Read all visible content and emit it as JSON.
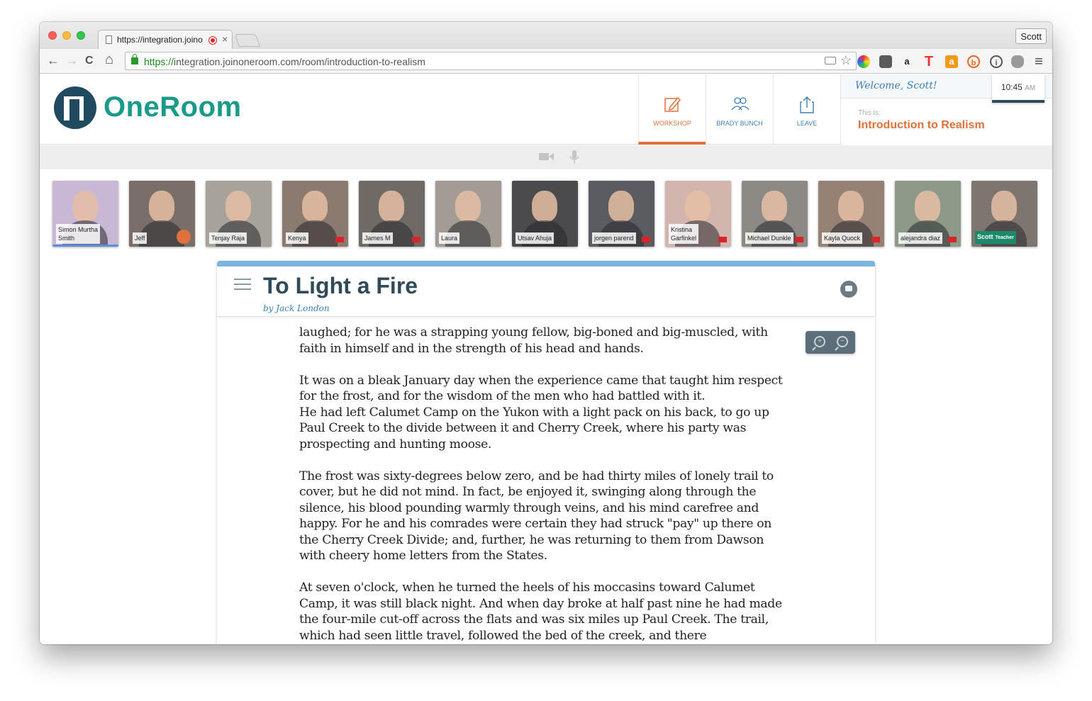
{
  "browser": {
    "tab_title": "https://integration.joino",
    "tab_close": "×",
    "profile": "Scott",
    "url_scheme": "https://",
    "url_rest": "integration.joinoneroom.com/room/introduction-to-realism",
    "nav_back": "←",
    "nav_forward": "→",
    "nav_reload": "C",
    "nav_home": "⌂",
    "star": "☆",
    "menu": "≡"
  },
  "app": {
    "logo_text": "OneRoom",
    "nav": [
      {
        "label": "WORKSHOP",
        "icon": "pencil-edit-icon",
        "active": true
      },
      {
        "label": "BRADY BUNCH",
        "icon": "people-icon",
        "active": false
      },
      {
        "label": "LEAVE",
        "icon": "share-exit-icon",
        "active": false
      }
    ],
    "welcome": "Welcome, Scott!",
    "clock_time": "10:45",
    "clock_ampm": "AM",
    "this_is": "This is:",
    "course_name": "Introduction to Realism"
  },
  "participants": [
    {
      "name": "Simon Murtha Smith",
      "line1": "Simon Murtha",
      "line2": "Smith",
      "bg": "#c9b7d6"
    },
    {
      "name": "Jeff",
      "bg": "#7a6f68",
      "mic": true
    },
    {
      "name": "Tenjay Raja",
      "bg": "#a7a29a"
    },
    {
      "name": "Kenya",
      "bg": "#8b7a70",
      "cam_off": true
    },
    {
      "name": "James M",
      "bg": "#6f6a66",
      "cam_off": true
    },
    {
      "name": "Laura",
      "bg": "#a39c95"
    },
    {
      "name": "Utsav Ahuja",
      "bg": "#4b4a4c"
    },
    {
      "name": "jorgen parend",
      "bg": "#5b5c62",
      "cam_off": true
    },
    {
      "name": "Kristina Garfinkel",
      "line1": "Kristina",
      "line2": "Garfinkel",
      "bg": "#d2b5ad",
      "cam_off": true
    },
    {
      "name": "Michael Dunkle",
      "bg": "#8d8a86",
      "cam_off": true
    },
    {
      "name": "Kayla Quock",
      "bg": "#958274",
      "cam_off": true
    },
    {
      "name": "alejandra diaz",
      "bg": "#8d9a89",
      "cam_off": true
    },
    {
      "name": "Scott",
      "teacher_label": "Teacher",
      "bg": "#7c766e",
      "teacher": true
    }
  ],
  "document": {
    "title": "To Light a Fire",
    "author": "by Jack London",
    "zoom_in": "+",
    "zoom_out": "−",
    "paragraphs": [
      "laughed; for he was a strapping young fellow, big-boned and big-muscled, with faith in himself and in the strength of his head and hands.",
      "It was on a bleak January day when the experience came that taught him respect for the frost, and for the wisdom of the men who had battled with it.\nHe had left Calumet Camp on the Yukon with a light pack on his back, to go up Paul Creek to the divide between it and Cherry Creek, where his party was prospecting and hunting moose.",
      "The frost was sixty-degrees below zero, and be had thirty miles of lonely trail to cover, but he did not mind. In fact, be enjoyed it, swinging along through the silence, his blood pounding warmly through veins, and his mind carefree and happy. For he and his comrades were certain they had struck \"pay\" up there on the Cherry Creek Divide; and, further, he was returning to them from Dawson with cheery home letters from the States.",
      "At seven o'clock, when he turned the heels of his moccasins toward Calumet Camp, it was still black night. And when day broke at half past nine he had made the four-mile cut-off across the flats and was six miles up Paul Creek. The trail, which had seen little travel, followed the bed of the creek, and there"
    ]
  },
  "colors": {
    "brand_teal": "#1a9a8a",
    "accent_orange": "#e0713a",
    "link_blue": "#3b7fb5",
    "title_navy": "#2f4a58"
  }
}
